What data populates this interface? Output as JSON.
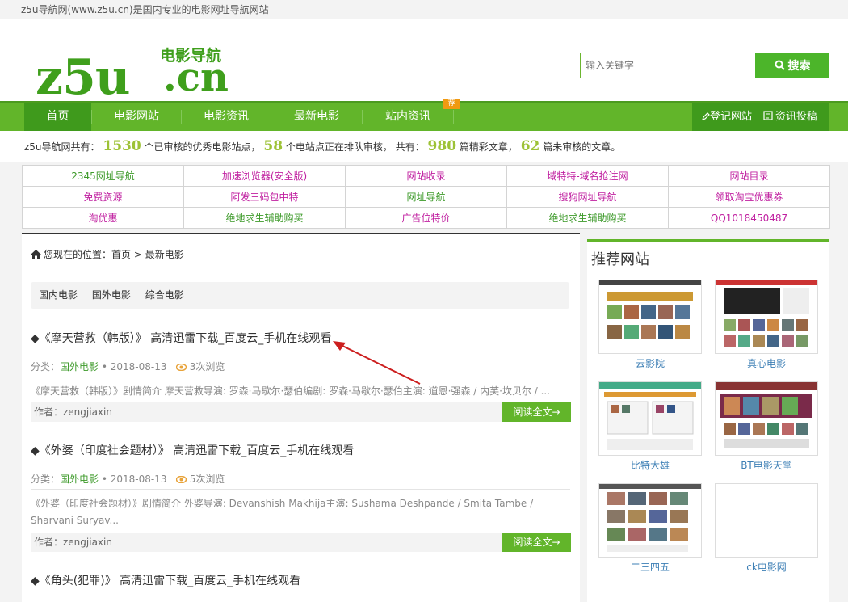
{
  "topbar": {
    "text": "z5u导航网(www.z5u.cn)是国内专业的电影网址导航网站"
  },
  "logo": {
    "main": "z5u",
    "dot_cn": ".cn",
    "tagline": "电影导航"
  },
  "search": {
    "placeholder": "输入关键字",
    "button": "搜索"
  },
  "nav": {
    "items": [
      "首页",
      "电影网站",
      "电影资讯",
      "最新电影",
      "站内资讯"
    ],
    "badge": "荐",
    "right": [
      "登记网站",
      "资讯投稿"
    ]
  },
  "stats": {
    "p1": "z5u导航网共有：",
    "n1": "1530",
    "p2": "个已审核的优秀电影站点，",
    "n2": "58",
    "p3": "个电站点正在排队审核，  共有：",
    "n3": "980",
    "p4": "篇精彩文章，",
    "n4": "62",
    "p5": "篇未审核的文章。"
  },
  "links": [
    [
      "2345网址导航",
      "加速浏览器(安全版)",
      "网站收录",
      "域特特-域名抢注网",
      "网站目录"
    ],
    [
      "免费资源",
      "阿发三码包中特",
      "网址导航",
      "搜狗网址导航",
      "领取淘宝优惠券"
    ],
    [
      "淘优惠",
      "绝地求生辅助购买",
      "广告位特价",
      "绝地求生辅助购买",
      "QQ1018450487"
    ]
  ],
  "breadcrumb": {
    "prefix": "您现在的位置：",
    "home": "首页",
    "sep": ">",
    "current": "最新电影"
  },
  "categories": [
    "国内电影",
    "国外电影",
    "综合电影"
  ],
  "posts": [
    {
      "title": "◆《摩天营救（韩版）》 高清迅雷下载_百度云_手机在线观看",
      "cat_label": "分类：",
      "cat": "国外电影",
      "date": "• 2018-08-13",
      "views": "3次浏览",
      "excerpt": "《摩天营救（韩版）》剧情简介 摩天营救导演: 罗森·马歇尔·瑟伯编剧: 罗森·马歇尔·瑟伯主演: 道恩·强森 / 内芙·坎贝尔 / ...",
      "author": "作者：zengjiaxin",
      "readmore": "阅读全文→"
    },
    {
      "title": "◆《外婆（印度社会题材）》 高清迅雷下载_百度云_手机在线观看",
      "cat_label": "分类：",
      "cat": "国外电影",
      "date": "• 2018-08-13",
      "views": "5次浏览",
      "excerpt": "《外婆（印度社会题材）》剧情简介 外婆导演: Devanshish Makhija主演: Sushama Deshpande / Smita Tambe / Sharvani Suryav...",
      "author": "作者：zengjiaxin",
      "readmore": "阅读全文→"
    },
    {
      "title": "◆《角头(犯罪)》 高清迅雷下载_百度云_手机在线观看"
    }
  ],
  "sidebar": {
    "title": "推荐网站",
    "sites": [
      "云影院",
      "真心电影",
      "比特大雄",
      "BT电影天堂",
      "二三四五",
      "ck电影网"
    ]
  },
  "colors": {
    "brand_green": "#62b52a",
    "dark_green": "#3f9a1c",
    "pink": "#c020a0",
    "number_green": "#9dc236"
  }
}
